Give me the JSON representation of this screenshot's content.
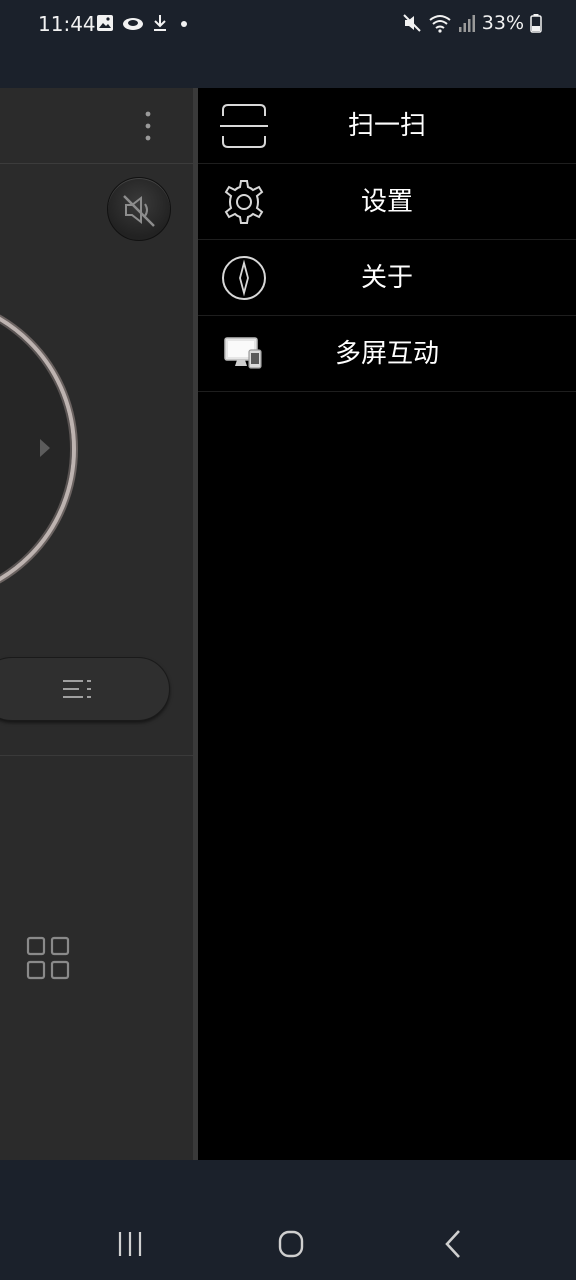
{
  "status_bar": {
    "time": "11:44",
    "battery": "33%",
    "icons": [
      "image-icon",
      "cloud-icon",
      "download-icon",
      "dot-icon",
      "mute-icon",
      "wifi-icon",
      "signal-icon",
      "battery-icon"
    ]
  },
  "drawer": {
    "items": [
      {
        "label": "扫一扫",
        "icon": "scan-icon"
      },
      {
        "label": "设置",
        "icon": "gear-icon"
      },
      {
        "label": "关于",
        "icon": "compass-icon"
      },
      {
        "label": "多屏互动",
        "icon": "multiscreen-icon"
      }
    ]
  },
  "remote": {
    "icons": [
      "more-options-icon",
      "mute-icon",
      "menu-icon",
      "apps-grid-icon"
    ]
  },
  "nav": {
    "icons": [
      "recents-icon",
      "home-icon",
      "back-icon"
    ]
  },
  "colors": {
    "drawer_bg": "#000000",
    "remote_bg": "#2b2b2b",
    "system_bar_bg": "#1b212b"
  }
}
